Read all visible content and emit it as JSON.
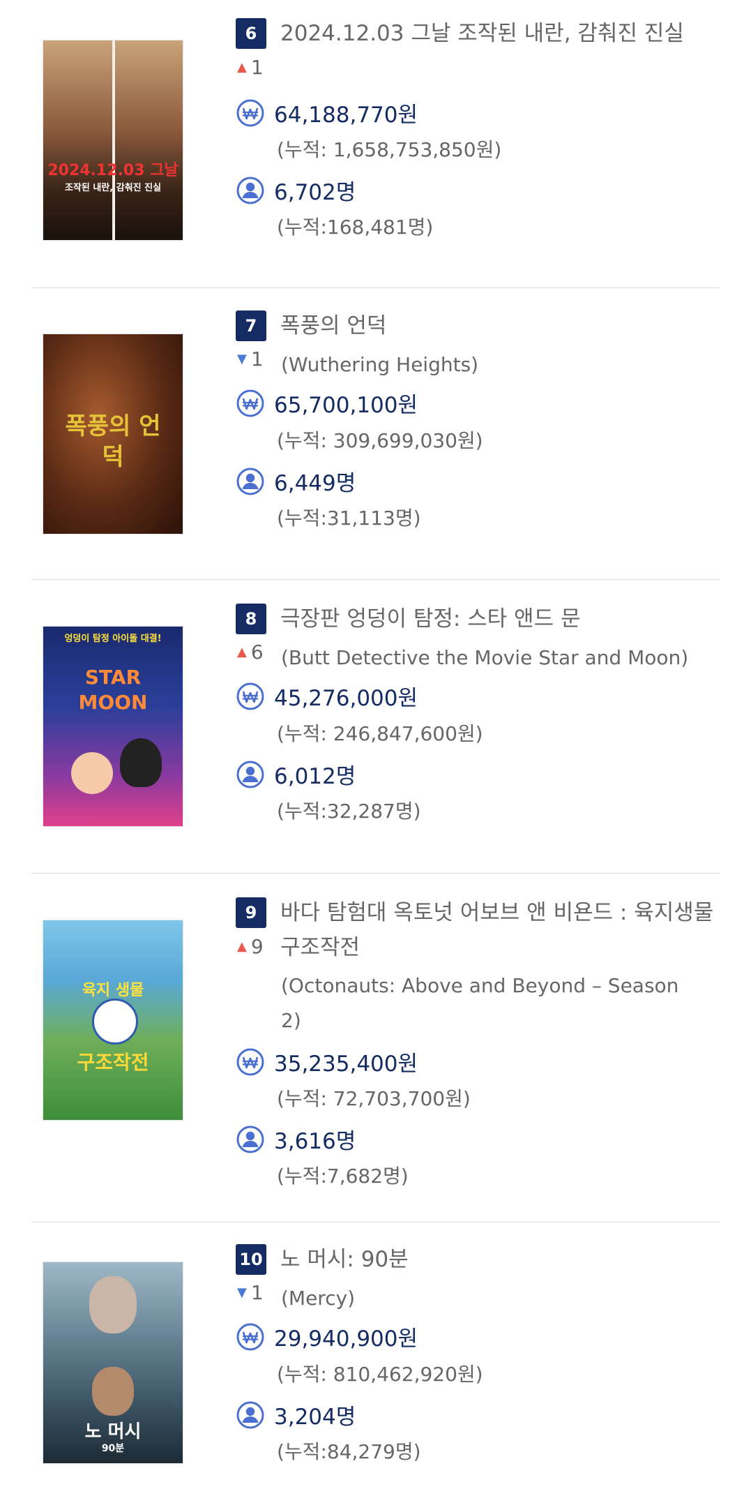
{
  "movies": [
    {
      "rank": "6",
      "title_ko": "2024.12.03 그날 조작된 내란, 감춰진 진실",
      "title_en": "",
      "change_dir": "up",
      "change": "1",
      "revenue": "64,188,770원",
      "revenue_cum": "(누적: 1,658,753,850원)",
      "audience": "6,702명",
      "audience_cum": "(누적:168,481명)",
      "poster_text": "2024.12.03 그날",
      "poster_sub": "조작된 내란, 감춰진 진실"
    },
    {
      "rank": "7",
      "title_ko": "폭풍의 언덕",
      "title_en": "(Wuthering Heights)",
      "change_dir": "down",
      "change": "1",
      "revenue": "65,700,100원",
      "revenue_cum": "(누적: 309,699,030원)",
      "audience": "6,449명",
      "audience_cum": "(누적:31,113명)",
      "poster_text": "폭풍의 언덕",
      "poster_sub": ""
    },
    {
      "rank": "8",
      "title_ko": "극장판 엉덩이 탐정: 스타 앤드 문",
      "title_en": "(Butt Detective the Movie Star and Moon)",
      "change_dir": "up",
      "change": "6",
      "revenue": "45,276,000원",
      "revenue_cum": "(누적: 246,847,600원)",
      "audience": "6,012명",
      "audience_cum": "(누적:32,287명)",
      "poster_text": "STAR MOON",
      "poster_sub": "엉덩이 탐정 아이돌 대결!"
    },
    {
      "rank": "9",
      "title_ko": "바다 탐험대 옥토넛 어보브 앤 비욘드 : 육지생물 구조작전",
      "title_en": "(Octonauts: Above and Beyond – Season 2)",
      "change_dir": "up",
      "change": "9",
      "revenue": "35,235,400원",
      "revenue_cum": "(누적: 72,703,700원)",
      "audience": "3,616명",
      "audience_cum": "(누적:7,682명)",
      "poster_text": "구조작전",
      "poster_sub": "육지 생물"
    },
    {
      "rank": "10",
      "title_ko": "노 머시: 90분",
      "title_en": "(Mercy)",
      "change_dir": "down",
      "change": "1",
      "revenue": "29,940,900원",
      "revenue_cum": "(누적: 810,462,920원)",
      "audience": "3,204명",
      "audience_cum": "(누적:84,279명)",
      "poster_text": "노 머시",
      "poster_sub": "90분"
    }
  ],
  "colors": {
    "badge": "#142b63",
    "value": "#142b63",
    "up": "#e8584c",
    "down": "#4a7bd3",
    "icon": "#4a6fd1"
  },
  "icons": {
    "revenue": "won-currency-icon",
    "audience": "person-icon",
    "up": "arrow-up-icon",
    "down": "arrow-down-icon"
  }
}
